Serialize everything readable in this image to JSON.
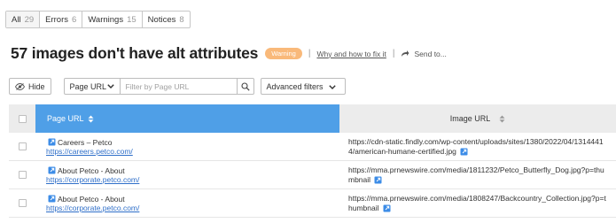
{
  "filters": [
    {
      "label": "All",
      "count": "29"
    },
    {
      "label": "Errors",
      "count": "6"
    },
    {
      "label": "Warnings",
      "count": "15"
    },
    {
      "label": "Notices",
      "count": "8"
    }
  ],
  "header": {
    "title": "57 images don't have alt attributes",
    "badge": "Warning",
    "why_link": "Why and how to fix it",
    "send_label": "Send to..."
  },
  "toolbar": {
    "hide_label": "Hide",
    "select_value": "Page URL",
    "filter_placeholder": "Filter by Page URL",
    "advanced_label": "Advanced filters"
  },
  "table": {
    "col_page": "Page URL",
    "col_image": "Image URL",
    "rows": [
      {
        "page_title": "Careers – Petco",
        "page_url": "https://careers.petco.com/",
        "image_url": "https://cdn-static.findly.com/wp-content/uploads/sites/1380/2022/04/13144414/american-humane-certified.jpg"
      },
      {
        "page_title": "About Petco - About",
        "page_url": "https://corporate.petco.com/",
        "image_url": "https://mma.prnewswire.com/media/1811232/Petco_Butterfly_Dog.jpg?p=thumbnail"
      },
      {
        "page_title": "About Petco - About",
        "page_url": "https://corporate.petco.com/",
        "image_url": "https://mma.prnewswire.com/media/1808247/Backcountry_Collection.jpg?p=thumbnail"
      }
    ]
  },
  "colors": {
    "accent": "#4f9fe7",
    "badge": "#f9b97a",
    "link": "#2f6fc9"
  },
  "icons": [
    "hide-icon",
    "chevron-down-icon",
    "search-icon",
    "share-icon",
    "external-link-icon",
    "sort-icon"
  ]
}
